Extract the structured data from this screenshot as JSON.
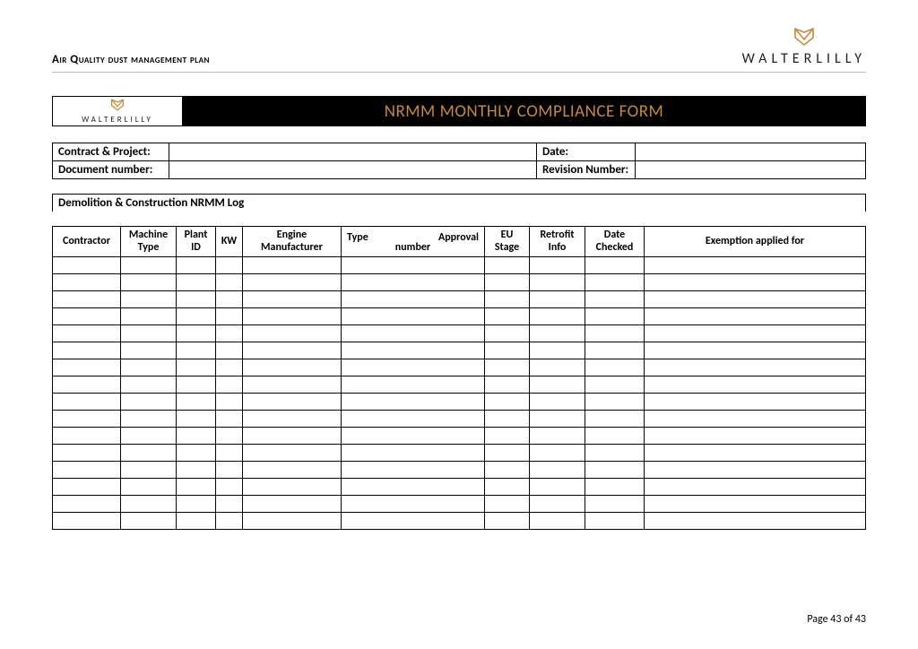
{
  "header": {
    "doc_title": "Air Quality dust management plan",
    "brand_text": "WALTERLILLY"
  },
  "banner": {
    "brand_text": "WALTERLILLY",
    "title": "NRMM MONTHLY COMPLIANCE FORM"
  },
  "meta": {
    "contract_project_label": "Contract & Project:",
    "contract_project_value": "",
    "date_label": "Date:",
    "date_value": "",
    "doc_number_label": "Document number:",
    "doc_number_value": "",
    "revision_label": "Revision Number:",
    "revision_value": ""
  },
  "log": {
    "caption": "Demolition & Construction NRMM Log",
    "columns": {
      "contractor": "Contractor",
      "machine_type": "Machine Type",
      "plant_id": "Plant ID",
      "kw": "KW",
      "engine_manufacturer": "Engine Manufacturer",
      "type": "Type",
      "approval": "Approval",
      "number": "number",
      "eu_stage": "EU Stage",
      "retrofit_info": "Retrofit Info",
      "date_checked": "Date Checked",
      "exemption": "Exemption applied for"
    },
    "row_count": 16
  },
  "footer": {
    "page_text": "Page 43 of 43"
  }
}
